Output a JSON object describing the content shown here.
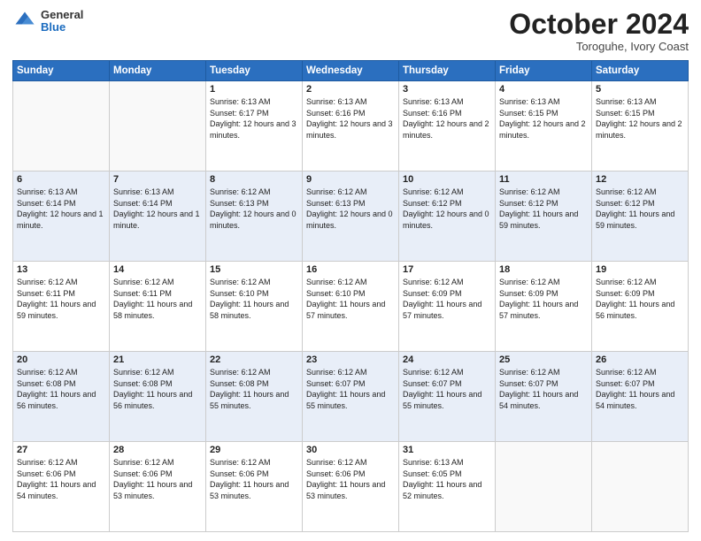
{
  "header": {
    "logo_general": "General",
    "logo_blue": "Blue",
    "month_title": "October 2024",
    "location": "Toroguhe, Ivory Coast"
  },
  "days_of_week": [
    "Sunday",
    "Monday",
    "Tuesday",
    "Wednesday",
    "Thursday",
    "Friday",
    "Saturday"
  ],
  "weeks": [
    [
      {
        "day": "",
        "info": ""
      },
      {
        "day": "",
        "info": ""
      },
      {
        "day": "1",
        "info": "Sunrise: 6:13 AM\nSunset: 6:17 PM\nDaylight: 12 hours and 3 minutes."
      },
      {
        "day": "2",
        "info": "Sunrise: 6:13 AM\nSunset: 6:16 PM\nDaylight: 12 hours and 3 minutes."
      },
      {
        "day": "3",
        "info": "Sunrise: 6:13 AM\nSunset: 6:16 PM\nDaylight: 12 hours and 2 minutes."
      },
      {
        "day": "4",
        "info": "Sunrise: 6:13 AM\nSunset: 6:15 PM\nDaylight: 12 hours and 2 minutes."
      },
      {
        "day": "5",
        "info": "Sunrise: 6:13 AM\nSunset: 6:15 PM\nDaylight: 12 hours and 2 minutes."
      }
    ],
    [
      {
        "day": "6",
        "info": "Sunrise: 6:13 AM\nSunset: 6:14 PM\nDaylight: 12 hours and 1 minute."
      },
      {
        "day": "7",
        "info": "Sunrise: 6:13 AM\nSunset: 6:14 PM\nDaylight: 12 hours and 1 minute."
      },
      {
        "day": "8",
        "info": "Sunrise: 6:12 AM\nSunset: 6:13 PM\nDaylight: 12 hours and 0 minutes."
      },
      {
        "day": "9",
        "info": "Sunrise: 6:12 AM\nSunset: 6:13 PM\nDaylight: 12 hours and 0 minutes."
      },
      {
        "day": "10",
        "info": "Sunrise: 6:12 AM\nSunset: 6:12 PM\nDaylight: 12 hours and 0 minutes."
      },
      {
        "day": "11",
        "info": "Sunrise: 6:12 AM\nSunset: 6:12 PM\nDaylight: 11 hours and 59 minutes."
      },
      {
        "day": "12",
        "info": "Sunrise: 6:12 AM\nSunset: 6:12 PM\nDaylight: 11 hours and 59 minutes."
      }
    ],
    [
      {
        "day": "13",
        "info": "Sunrise: 6:12 AM\nSunset: 6:11 PM\nDaylight: 11 hours and 59 minutes."
      },
      {
        "day": "14",
        "info": "Sunrise: 6:12 AM\nSunset: 6:11 PM\nDaylight: 11 hours and 58 minutes."
      },
      {
        "day": "15",
        "info": "Sunrise: 6:12 AM\nSunset: 6:10 PM\nDaylight: 11 hours and 58 minutes."
      },
      {
        "day": "16",
        "info": "Sunrise: 6:12 AM\nSunset: 6:10 PM\nDaylight: 11 hours and 57 minutes."
      },
      {
        "day": "17",
        "info": "Sunrise: 6:12 AM\nSunset: 6:09 PM\nDaylight: 11 hours and 57 minutes."
      },
      {
        "day": "18",
        "info": "Sunrise: 6:12 AM\nSunset: 6:09 PM\nDaylight: 11 hours and 57 minutes."
      },
      {
        "day": "19",
        "info": "Sunrise: 6:12 AM\nSunset: 6:09 PM\nDaylight: 11 hours and 56 minutes."
      }
    ],
    [
      {
        "day": "20",
        "info": "Sunrise: 6:12 AM\nSunset: 6:08 PM\nDaylight: 11 hours and 56 minutes."
      },
      {
        "day": "21",
        "info": "Sunrise: 6:12 AM\nSunset: 6:08 PM\nDaylight: 11 hours and 56 minutes."
      },
      {
        "day": "22",
        "info": "Sunrise: 6:12 AM\nSunset: 6:08 PM\nDaylight: 11 hours and 55 minutes."
      },
      {
        "day": "23",
        "info": "Sunrise: 6:12 AM\nSunset: 6:07 PM\nDaylight: 11 hours and 55 minutes."
      },
      {
        "day": "24",
        "info": "Sunrise: 6:12 AM\nSunset: 6:07 PM\nDaylight: 11 hours and 55 minutes."
      },
      {
        "day": "25",
        "info": "Sunrise: 6:12 AM\nSunset: 6:07 PM\nDaylight: 11 hours and 54 minutes."
      },
      {
        "day": "26",
        "info": "Sunrise: 6:12 AM\nSunset: 6:07 PM\nDaylight: 11 hours and 54 minutes."
      }
    ],
    [
      {
        "day": "27",
        "info": "Sunrise: 6:12 AM\nSunset: 6:06 PM\nDaylight: 11 hours and 54 minutes."
      },
      {
        "day": "28",
        "info": "Sunrise: 6:12 AM\nSunset: 6:06 PM\nDaylight: 11 hours and 53 minutes."
      },
      {
        "day": "29",
        "info": "Sunrise: 6:12 AM\nSunset: 6:06 PM\nDaylight: 11 hours and 53 minutes."
      },
      {
        "day": "30",
        "info": "Sunrise: 6:12 AM\nSunset: 6:06 PM\nDaylight: 11 hours and 53 minutes."
      },
      {
        "day": "31",
        "info": "Sunrise: 6:13 AM\nSunset: 6:05 PM\nDaylight: 11 hours and 52 minutes."
      },
      {
        "day": "",
        "info": ""
      },
      {
        "day": "",
        "info": ""
      }
    ]
  ]
}
